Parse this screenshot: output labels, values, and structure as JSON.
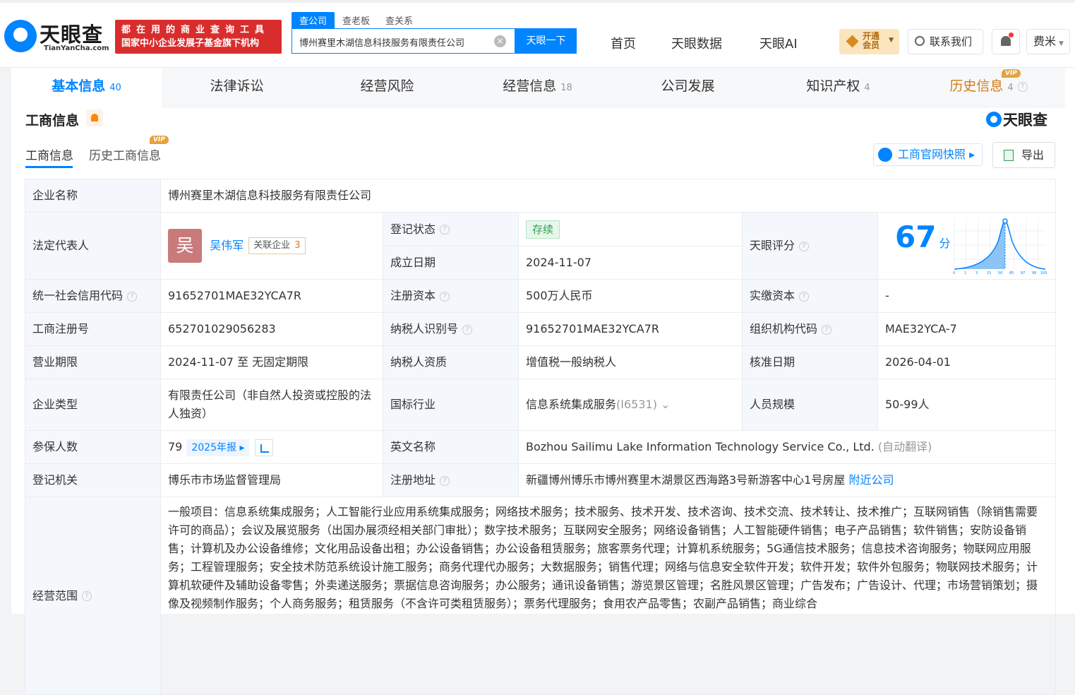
{
  "header": {
    "logo_name": "天眼查",
    "logo_domain": "TianYanCha.com",
    "slogan_line1": "都在用的商业查询工具",
    "slogan_line2": "国家中小企业发展子基金旗下机构",
    "search_tabs": [
      "查公司",
      "查老板",
      "查关系"
    ],
    "search_value": "博州赛里木湖信息科技服务有限责任公司",
    "search_button": "天眼一下",
    "nav": [
      "首页",
      "天眼数据",
      "天眼AI"
    ],
    "vip_line1": "开通",
    "vip_line2": "会员",
    "contact": "联系我们",
    "user": "费米"
  },
  "tabs": [
    {
      "label": "基本信息",
      "count": "40"
    },
    {
      "label": "法律诉讼",
      "count": ""
    },
    {
      "label": "经营风险",
      "count": ""
    },
    {
      "label": "经营信息",
      "count": "18"
    },
    {
      "label": "公司发展",
      "count": ""
    },
    {
      "label": "知识产权",
      "count": "4"
    },
    {
      "label": "历史信息",
      "count": "4",
      "vip": "VIP"
    }
  ],
  "section": {
    "title": "工商信息",
    "brand": "天眼查",
    "subtab1": "工商信息",
    "subtab2": "历史工商信息",
    "subtab2_vip": "VIP",
    "snapshot": "工商官网快照",
    "export": "导出"
  },
  "info": {
    "k_name": "企业名称",
    "v_name": "博州赛里木湖信息科技服务有限责任公司",
    "k_legal": "法定代表人",
    "legal_avatar": "吴",
    "legal_name": "吴伟军",
    "legal_rel": "关联企业",
    "legal_rel_n": "3",
    "k_status": "登记状态",
    "v_status": "存续",
    "k_est": "成立日期",
    "v_est": "2024-11-07",
    "k_score": "天眼评分",
    "v_score": "67",
    "score_unit": "分",
    "score_ticks": [
      "0",
      "1",
      "3",
      "15",
      "50",
      "85",
      "97",
      "99",
      "100"
    ],
    "k_credit": "统一社会信用代码",
    "v_credit": "91652701MAE32YCA7R",
    "k_capital": "注册资本",
    "v_capital": "500万人民币",
    "k_paid": "实缴资本",
    "v_paid": "-",
    "k_regno": "工商注册号",
    "v_regno": "652701029056283",
    "k_tax": "纳税人识别号",
    "v_tax": "91652701MAE32YCA7R",
    "k_org": "组织机构代码",
    "v_org": "MAE32YCA-7",
    "k_term": "营业期限",
    "v_term": "2024-11-07 至 无固定期限",
    "k_taxq": "纳税人资质",
    "v_taxq": "增值税一般纳税人",
    "k_appr": "核准日期",
    "v_appr": "2026-04-01",
    "k_type": "企业类型",
    "v_type": "有限责任公司（非自然人投资或控股的法人独资）",
    "k_ind": "国标行业",
    "v_ind": "信息系统集成服务",
    "v_ind_code": "(I6531)",
    "k_staff": "人员规模",
    "v_staff": "50-99人",
    "k_ins": "参保人数",
    "v_ins": "79",
    "v_ins_year": "2025年报",
    "k_en": "英文名称",
    "v_en": "Bozhou Sailimu Lake Information Technology Service Co., Ltd.",
    "v_en_note": "(自动翻译)",
    "k_auth": "登记机关",
    "v_auth": "博乐市市场监督管理局",
    "k_addr": "注册地址",
    "v_addr": "新疆博州博乐市博州赛里木湖景区西海路3号新游客中心1号房屋",
    "v_addr_link": "附近公司",
    "k_scope": "经营范围",
    "v_scope": "一般项目：信息系统集成服务；人工智能行业应用系统集成服务；网络技术服务；技术服务、技术开发、技术咨询、技术交流、技术转让、技术推广；互联网销售（除销售需要许可的商品）；会议及展览服务（出国办展须经相关部门审批）；数字技术服务；互联网安全服务；网络设备销售；人工智能硬件销售；电子产品销售；软件销售；安防设备销售；计算机及办公设备维修；文化用品设备出租；办公设备销售；办公设备租赁服务；旅客票务代理；计算机系统服务；5G通信技术服务；信息技术咨询服务；物联网应用服务；工程管理服务；安全技术防范系统设计施工服务；商务代理代办服务；大数据服务；销售代理；网络与信息安全软件开发；软件开发；软件外包服务；物联网技术服务；计算机软硬件及辅助设备零售；外卖递送服务；票据信息咨询服务；办公服务；通讯设备销售；游览景区管理；名胜风景区管理；广告发布；广告设计、代理；市场营销策划；摄像及视频制作服务；个人商务服务；租赁服务（不含许可类租赁服务）；票务代理服务；食用农产品零售；农副产品销售；商业综合"
  },
  "colors": {
    "accent": "#0084ff",
    "slogan_bg": "#d92d2d",
    "history": "#d47b16"
  }
}
